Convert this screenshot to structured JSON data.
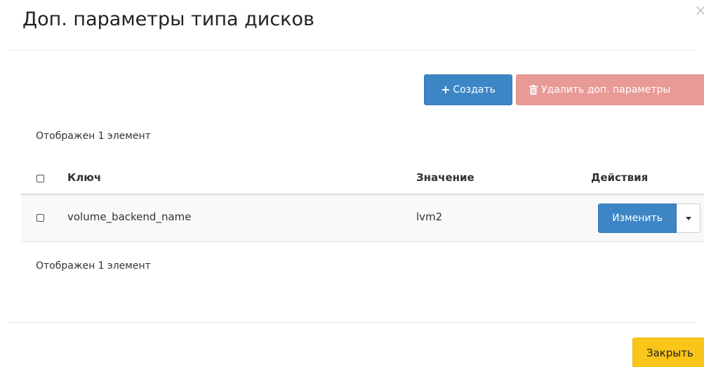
{
  "modal": {
    "title": "Доп. параметры типа дисков",
    "close_icon": "close-icon",
    "close_glyph": "×"
  },
  "toolbar": {
    "create_label": "Создать",
    "create_icon": "plus-icon",
    "create_glyph": "+",
    "delete_label": "Удалить доп. параметры",
    "delete_icon": "trash-icon"
  },
  "summary": {
    "count_top": "Отображен 1 элемент",
    "count_bottom": "Отображен 1 элемент"
  },
  "table": {
    "columns": [
      "Ключ",
      "Значение",
      "Действия"
    ],
    "rows": [
      {
        "key": "volume_backend_name",
        "value": "lvm2",
        "action_label": "Изменить",
        "dropdown_icon": "caret-down-icon"
      }
    ]
  },
  "footer": {
    "close_label": "Закрыть"
  },
  "colors": {
    "primary": "#3c86c6",
    "danger_disabled": "#e89a97",
    "warning": "#f9c518",
    "row_background": "#f9f9f9"
  }
}
